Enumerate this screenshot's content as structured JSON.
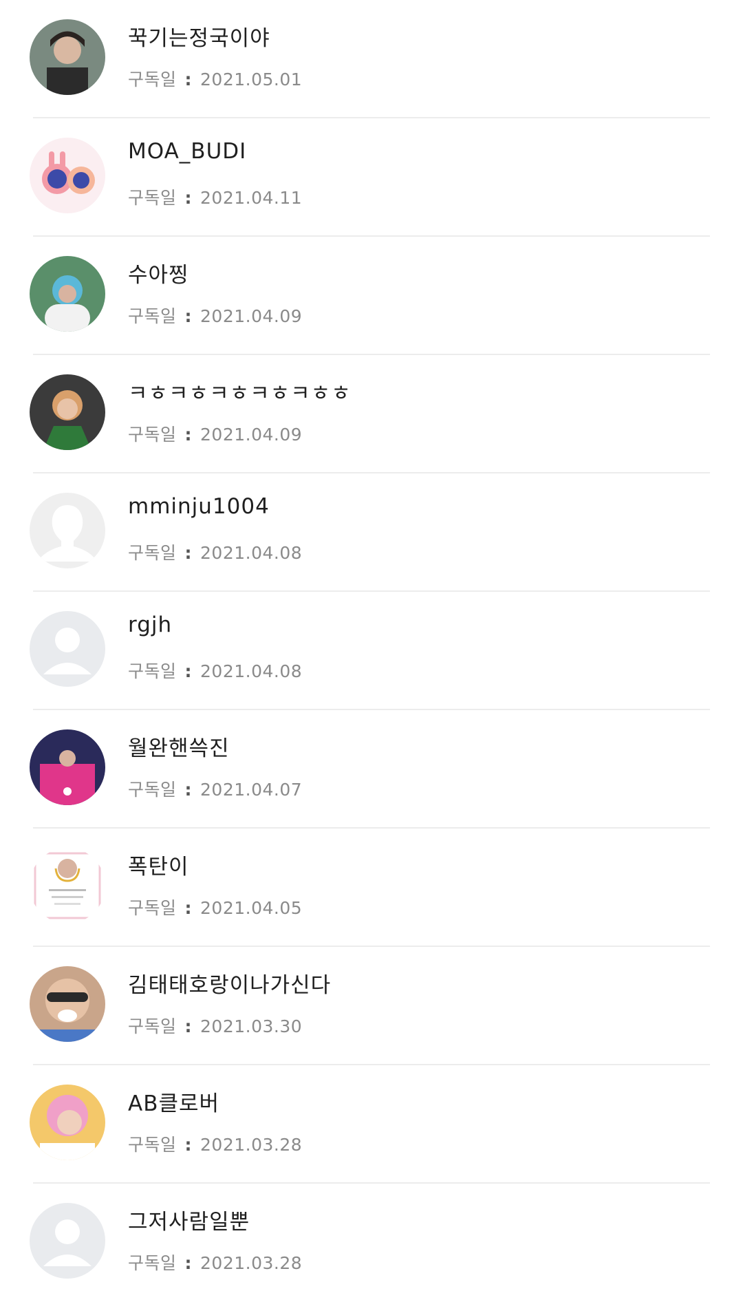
{
  "subscribers": [
    {
      "name": "꾹기는정국이야",
      "date": "2021.05.01",
      "avatar": "photo-dark"
    },
    {
      "name": "MOA_BUDI",
      "date": "2021.04.11",
      "avatar": "illustration-pink"
    },
    {
      "name": "수아찡",
      "date": "2021.04.09",
      "avatar": "photo-blue"
    },
    {
      "name": "ㅋㅎㅋㅎㅋㅎㅋㅎㅋㅎㅎ",
      "date": "2021.04.09",
      "avatar": "photo-green"
    },
    {
      "name": "mminju1004",
      "date": "2021.04.08",
      "avatar": "default-silhouette"
    },
    {
      "name": "rgjh",
      "date": "2021.04.08",
      "avatar": "default-person"
    },
    {
      "name": "월완핸쓱진",
      "date": "2021.04.07",
      "avatar": "photo-pink"
    },
    {
      "name": "폭탄이",
      "date": "2021.04.05",
      "avatar": "certificate"
    },
    {
      "name": "김태태호랑이나가신다",
      "date": "2021.03.30",
      "avatar": "photo-face"
    },
    {
      "name": "AB클로버",
      "date": "2021.03.28",
      "avatar": "photo-pinkhair"
    },
    {
      "name": "그저사람일뿐",
      "date": "2021.03.28",
      "avatar": "default-person"
    }
  ],
  "labels": {
    "subscribed": "구독일",
    "separator": ":"
  },
  "colors": {
    "divider": "#ececec",
    "name_text": "#1f1f1f",
    "date_text": "#8a8a8a",
    "default_avatar_bg": "#e9ebee",
    "default_avatar_fg": "#ffffff"
  }
}
